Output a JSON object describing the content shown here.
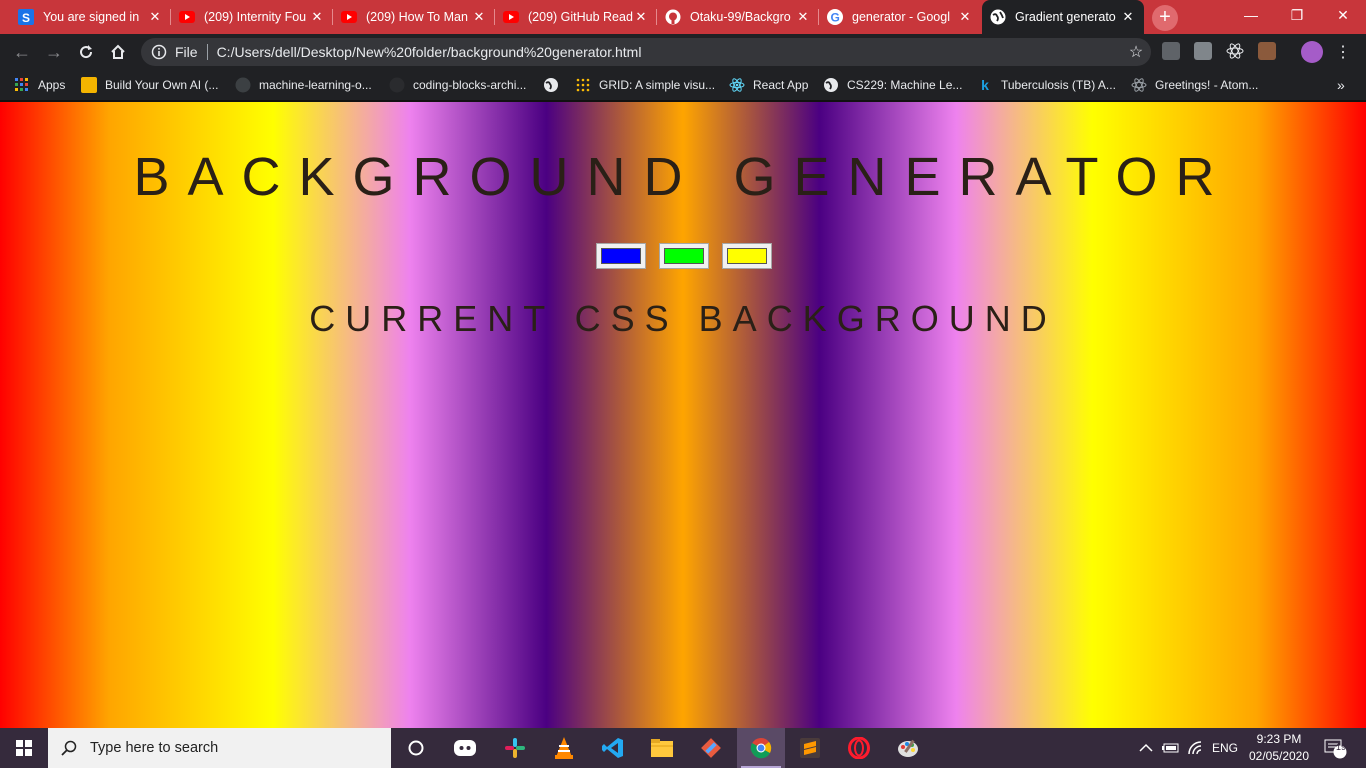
{
  "browser": {
    "tabs": [
      {
        "title": "You are signed in",
        "favicon": "s-icon",
        "color": "#1a73e8"
      },
      {
        "title": "(209) Internity Fou",
        "favicon": "youtube-icon",
        "color": "#ff0000"
      },
      {
        "title": "(209) How To Man",
        "favicon": "youtube-icon",
        "color": "#ff0000"
      },
      {
        "title": "(209) GitHub Read",
        "favicon": "youtube-icon",
        "color": "#ff0000"
      },
      {
        "title": "Otaku-99/Backgro",
        "favicon": "github-icon",
        "color": "#ffffff"
      },
      {
        "title": "generator - Googl",
        "favicon": "google-icon",
        "color": "#4285f4"
      },
      {
        "title": "Gradient generato",
        "favicon": "globe-icon",
        "color": "#ffffff",
        "active": true
      }
    ],
    "new_tab_label": "+",
    "address": {
      "scheme_label": "File",
      "url": "C:/Users/dell/Desktop/New%20folder/background%20generator.html"
    },
    "bookmarks": [
      {
        "label": "Apps",
        "icon": "apps-grid-icon"
      },
      {
        "label": "Build Your Own AI (...",
        "icon": "bookmark-icon"
      },
      {
        "label": "machine-learning-o...",
        "icon": "github-icon"
      },
      {
        "label": "coding-blocks-archi...",
        "icon": "github-icon"
      },
      {
        "label": "",
        "icon": "globe-icon"
      },
      {
        "label": "GRID: A simple visu...",
        "icon": "grid-dots-icon"
      },
      {
        "label": "React App",
        "icon": "react-icon"
      },
      {
        "label": "CS229: Machine Le...",
        "icon": "globe-icon"
      },
      {
        "label": "Tuberculosis (TB) A...",
        "icon": "k-icon"
      },
      {
        "label": "Greetings! - Atom...",
        "icon": "atom-icon"
      }
    ],
    "bookmarks_more": "»"
  },
  "page": {
    "title": "BACKGROUND GENERATOR",
    "subtitle": "CURRENT CSS BACKGROUND",
    "color_inputs": [
      {
        "name": "color1",
        "value": "#0000ff"
      },
      {
        "name": "color2",
        "value": "#00ff00"
      },
      {
        "name": "color3",
        "value": "#ffff00"
      }
    ],
    "gradient_colors": [
      "#ff0000",
      "#ffa500",
      "#ffff00",
      "#ee82ee",
      "#4b0082",
      "#ffa500",
      "#4b0082",
      "#ee82ee",
      "#ffff00",
      "#ffa500",
      "#ff0000"
    ]
  },
  "taskbar": {
    "search_placeholder": "Type here to search",
    "apps": [
      "cortana-icon",
      "discord-icon",
      "slack-icon",
      "vlc-icon",
      "vscode-icon",
      "file-explorer-icon",
      "git-icon",
      "chrome-icon",
      "sublime-icon",
      "opera-icon",
      "paint-icon"
    ],
    "language": "ENG",
    "time": "9:23 PM",
    "date": "02/05/2020",
    "notification_count": "19"
  }
}
